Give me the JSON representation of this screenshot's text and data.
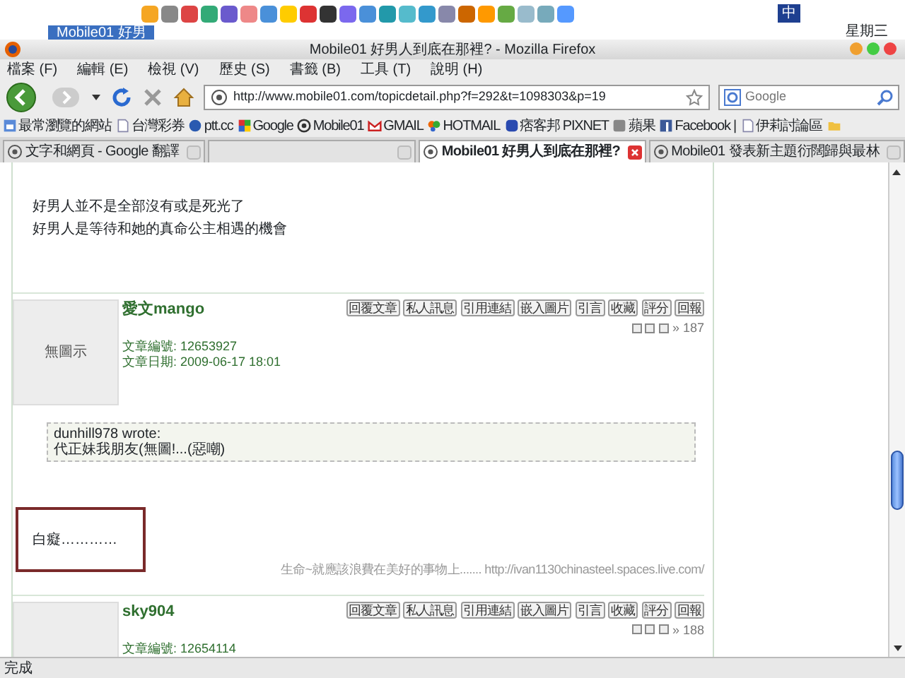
{
  "taskbar": {
    "window_button": "Mobile01 好男",
    "input_method": "中",
    "day": "星期三"
  },
  "window": {
    "title": "Mobile01 好男人到底在那裡? - Mozilla Firefox"
  },
  "menu": [
    "檔案 (F)",
    "編輯 (E)",
    "檢視 (V)",
    "歷史 (S)",
    "書籤 (B)",
    "工具 (T)",
    "說明 (H)"
  ],
  "toolbar": {
    "url": "http://www.mobile01.com/topicdetail.php?f=292&t=1098303&p=19",
    "search_placeholder": "Google"
  },
  "bookmarks": [
    {
      "label": "最常瀏覽的網站",
      "kind": "star"
    },
    {
      "label": "台灣彩券",
      "kind": "page"
    },
    {
      "label": "ptt.cc",
      "kind": "circle"
    },
    {
      "label": "Google",
      "kind": "google"
    },
    {
      "label": "Mobile01",
      "kind": "mobile"
    },
    {
      "label": "GMAIL",
      "kind": "mail"
    },
    {
      "label": "HOTMAIL",
      "kind": "butterfly"
    },
    {
      "label": "痞客邦 PIXNET",
      "kind": "pixnet"
    },
    {
      "label": "蘋果",
      "kind": "apple"
    },
    {
      "label": "Facebook |",
      "kind": "facebook"
    },
    {
      "label": "伊莉討論區",
      "kind": "page"
    },
    {
      "kind": "folder"
    }
  ],
  "tabs": [
    {
      "label": "文字和網頁 - Google 翻譯",
      "selected": false
    },
    {
      "selected": false
    },
    {
      "label": "Mobile01 好男人到底在那裡?",
      "selected": true
    },
    {
      "label": "Mobile01 發表新主題衍闊歸與最林",
      "selected": false
    }
  ],
  "content": {
    "intro_lines": [
      "好男人並不是全部沒有或是死光了",
      "好男人是等待和她的真命公主相遇的機會"
    ],
    "posts": [
      {
        "avatar": "無圖示",
        "username": "愛文mango",
        "buttons": [
          "回覆文章",
          "私人訊息",
          "引用連結",
          "嵌入圖片",
          "引言",
          "收藏",
          "評分",
          "回報"
        ],
        "floor": "» 187",
        "id_label": "文章編號:",
        "id": "12653927",
        "date_label": "文章日期:",
        "date": "2009-06-17 18:01",
        "quote": {
          "author": "dunhill978 wrote:",
          "text": "代正妹我朋友(無圖!...(惡嘲)"
        },
        "body": "白癡…………",
        "signature": "生命~就應該浪費在美好的事物上....... http://ivan1130chinasteel.spaces.live.com/"
      },
      {
        "username": "sky904",
        "buttons": [
          "回覆文章",
          "私人訊息",
          "引用連結",
          "嵌入圖片",
          "引言",
          "收藏",
          "評分",
          "回報"
        ],
        "floor": "» 188",
        "id_label": "文章編號:",
        "id": "12654114"
      }
    ]
  },
  "status_bar": "完成"
}
